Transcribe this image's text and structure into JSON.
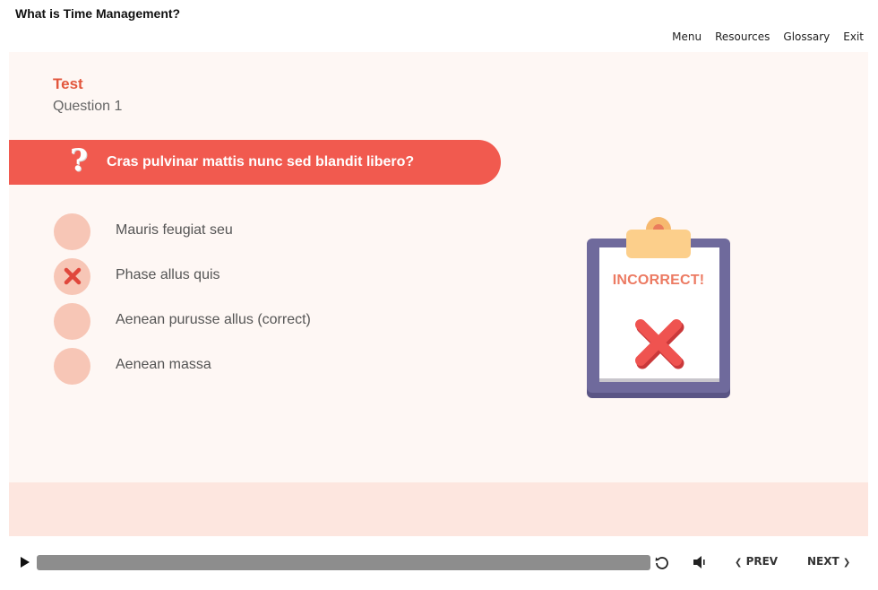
{
  "course": {
    "title": "What is Time Management?"
  },
  "nav": {
    "menu": "Menu",
    "resources": "Resources",
    "glossary": "Glossary",
    "exit": "Exit"
  },
  "slide": {
    "section": "Test",
    "question_number": "Question 1",
    "question": "Cras pulvinar mattis nunc sed blandit libero?",
    "options": [
      {
        "label": "Mauris feugiat seu",
        "selected": false
      },
      {
        "label": "Phase allus quis",
        "selected": true,
        "marked_incorrect": true
      },
      {
        "label": "Aenean purusse allus (correct)",
        "selected": false
      },
      {
        "label": "Aenean massa",
        "selected": false
      }
    ],
    "feedback": {
      "text": "INCORRECT!",
      "icon": "x-icon"
    }
  },
  "player": {
    "play_icon": "play-icon",
    "replay_icon": "replay-icon",
    "volume_icon": "volume-icon",
    "prev_label": "PREV",
    "next_label": "NEXT"
  },
  "colors": {
    "accent": "#f15a4f",
    "section_title": "#e2563c",
    "slide_bg": "#fef7f4",
    "footer_bg": "#fde6df",
    "radio": "#f7c6b6",
    "clipboard_board": "#6f6a9c",
    "clipboard_clip": "#fccf8b",
    "feedback_text": "#ec7a62"
  }
}
